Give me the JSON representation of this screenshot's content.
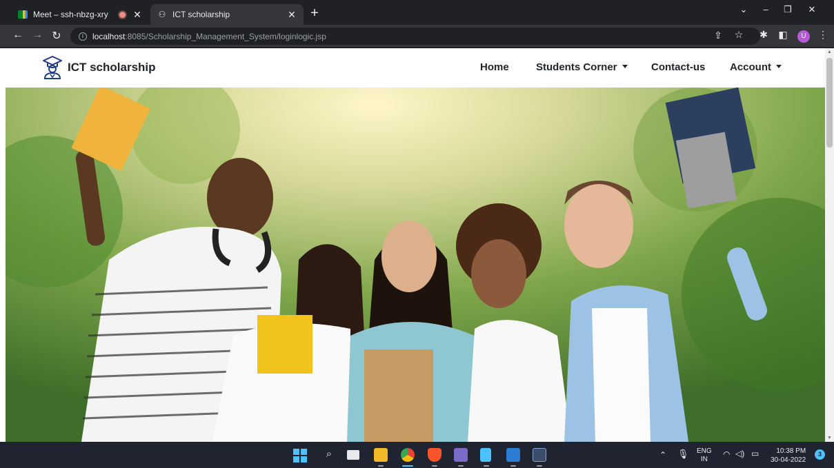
{
  "browser": {
    "tabs": [
      {
        "title": "Meet – ssh-nbzg-xry",
        "recording": true
      },
      {
        "title": "ICT scholarship",
        "active": true
      }
    ],
    "url_host": "localhost",
    "url_path": ":8085/Scholarship_Management_System/loginlogic.jsp",
    "profile_initial": "U"
  },
  "site": {
    "brand": "ICT scholarship",
    "nav": {
      "home": "Home",
      "students_corner": "Students Corner",
      "contact": "Contact-us",
      "account": "Account"
    },
    "hero_image": "group of smiling students holding books outdoors"
  },
  "taskbar": {
    "language_top": "ENG",
    "language_bottom": "IN",
    "time": "10:38 PM",
    "date": "30-04-2022",
    "notification_count": "3"
  },
  "colors": {
    "tab_strip": "#202124",
    "toolbar": "#35363a",
    "navbar_bg": "#ffffff",
    "nav_text": "#212529",
    "taskbar": "#1f2430"
  }
}
